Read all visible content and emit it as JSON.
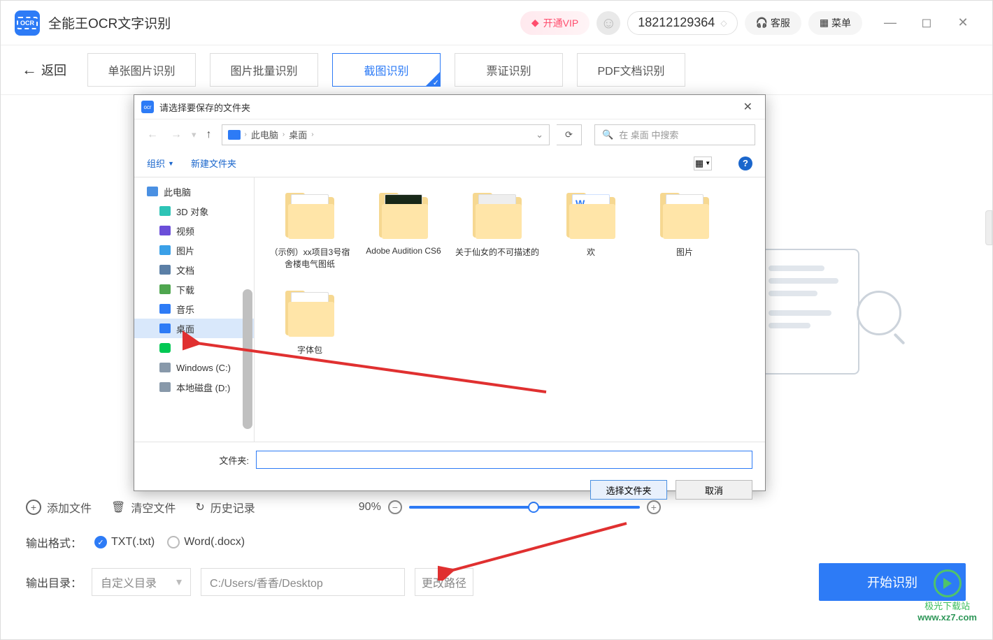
{
  "app": {
    "title": "全能王OCR文字识别",
    "logo_text": "OCR"
  },
  "topbar": {
    "vip_label": "开通VIP",
    "phone": "18212129364",
    "service_label": "客服",
    "menu_label": "菜单"
  },
  "tabs": {
    "back_label": "返回",
    "items": [
      {
        "label": "单张图片识别"
      },
      {
        "label": "图片批量识别"
      },
      {
        "label": "截图识别"
      },
      {
        "label": "票证识别"
      },
      {
        "label": "PDF文档识别"
      }
    ],
    "active_index": 2
  },
  "toolbar": {
    "add_file": "添加文件",
    "clear_file": "清空文件",
    "history": "历史记录",
    "zoom_percent": "90%"
  },
  "format": {
    "label": "输出格式：",
    "txt_label": "TXT(.txt)",
    "word_label": "Word(.docx)",
    "selected": "txt"
  },
  "output": {
    "label": "输出目录：",
    "mode": "自定义目录",
    "path": "C:/Users/香香/Desktop",
    "change_label": "更改路径",
    "start_label": "开始识别"
  },
  "dialog": {
    "title": "请选择要保存的文件夹",
    "breadcrumb": {
      "pc": "此电脑",
      "desktop": "桌面"
    },
    "search_placeholder": "在 桌面 中搜索",
    "toolbar": {
      "organize": "组织",
      "new_folder": "新建文件夹"
    },
    "tree": [
      {
        "label": "此电脑",
        "icon": "pc",
        "indent": 0
      },
      {
        "label": "3D 对象",
        "icon": "3d",
        "indent": 1
      },
      {
        "label": "视频",
        "icon": "video",
        "indent": 1
      },
      {
        "label": "图片",
        "icon": "pic",
        "indent": 1
      },
      {
        "label": "文档",
        "icon": "doc",
        "indent": 1
      },
      {
        "label": "下载",
        "icon": "dl",
        "indent": 1
      },
      {
        "label": "音乐",
        "icon": "music",
        "indent": 1
      },
      {
        "label": "桌面",
        "icon": "desk",
        "indent": 1,
        "selected": true
      },
      {
        "label": "",
        "icon": "iqiyi",
        "indent": 1
      },
      {
        "label": "Windows (C:)",
        "icon": "drive",
        "indent": 1
      },
      {
        "label": "本地磁盘 (D:)",
        "icon": "drive",
        "indent": 1
      }
    ],
    "files": [
      {
        "label": "（示例）xx项目3号宿舍楼电气图纸",
        "thumb": "folder"
      },
      {
        "label": "Adobe Audition CS6",
        "thumb": "adobe"
      },
      {
        "label": "关于仙女的不可描述的",
        "thumb": "photo"
      },
      {
        "label": "欢",
        "thumb": "word"
      },
      {
        "label": "图片",
        "thumb": "folder"
      },
      {
        "label": "字体包",
        "thumb": "folder"
      }
    ],
    "fname_label": "文件夹:",
    "fname_value": "",
    "select_btn": "选择文件夹",
    "cancel_btn": "取消"
  },
  "watermark": {
    "line1": "极光下载站",
    "line2": "www.xz7.com"
  }
}
